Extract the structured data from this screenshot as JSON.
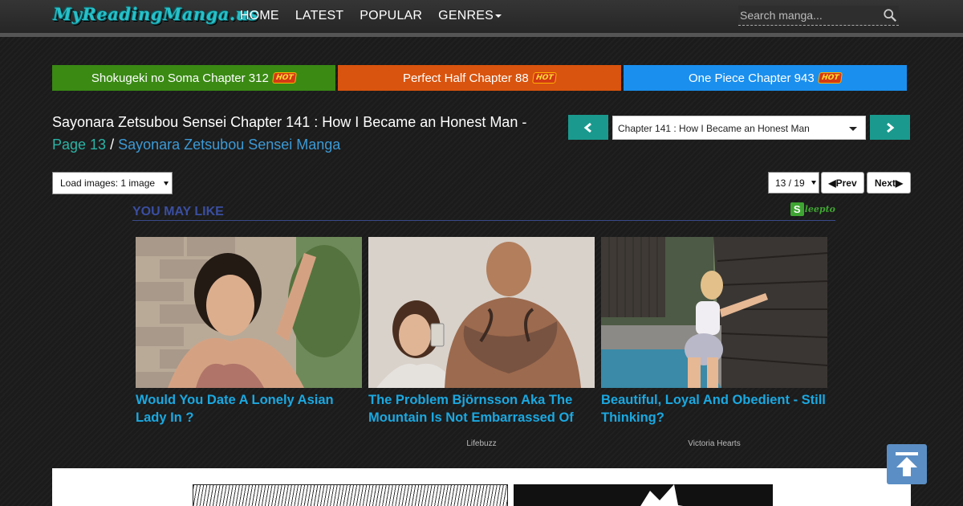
{
  "site": {
    "logo_text": "MyReadingManga.us"
  },
  "nav": {
    "items": [
      "HOME",
      "LATEST",
      "POPULAR"
    ],
    "genres_label": "GENRES"
  },
  "search": {
    "placeholder": "Search manga..."
  },
  "hot_chapters": [
    {
      "label": "Shokugeki no Soma Chapter 312",
      "badge": "HOT",
      "color": "#3a8a14"
    },
    {
      "label": "Perfect Half Chapter 88",
      "badge": "HOT",
      "color": "#d9540e"
    },
    {
      "label": "One Piece Chapter 943",
      "badge": "HOT",
      "color": "#1a8fee"
    }
  ],
  "chapter": {
    "title": "Sayonara Zetsubou Sensei Chapter 141 : How I Became an Honest Man -",
    "page_label": "Page 13",
    "separator": "/",
    "manga_link": "Sayonara Zetsubou Sensei Manga",
    "selected_chapter": "Chapter 141 : How I Became an Honest Man"
  },
  "reader_controls": {
    "load_images": "Load images: 1 image",
    "page_select": "13 / 19",
    "prev_label": "Prev",
    "next_label": "Next"
  },
  "recommendations": {
    "heading": "YOU MAY LIKE",
    "provider_s": "S",
    "provider": "leepto",
    "cards": [
      {
        "title": "Would You Date A Lonely Asian Lady In ?",
        "source": ""
      },
      {
        "title": "The Problem Björnsson Aka The Mountain Is Not Embarrassed Of",
        "source": "Lifebuzz"
      },
      {
        "title": "Beautiful, Loyal And Obedient - Still Thinking?",
        "source": "Victoria Hearts"
      }
    ]
  },
  "colors": {
    "accent_teal": "#1a9a8e",
    "link_blue": "#3c9ad6",
    "card_title_blue": "#1ba8e0"
  }
}
